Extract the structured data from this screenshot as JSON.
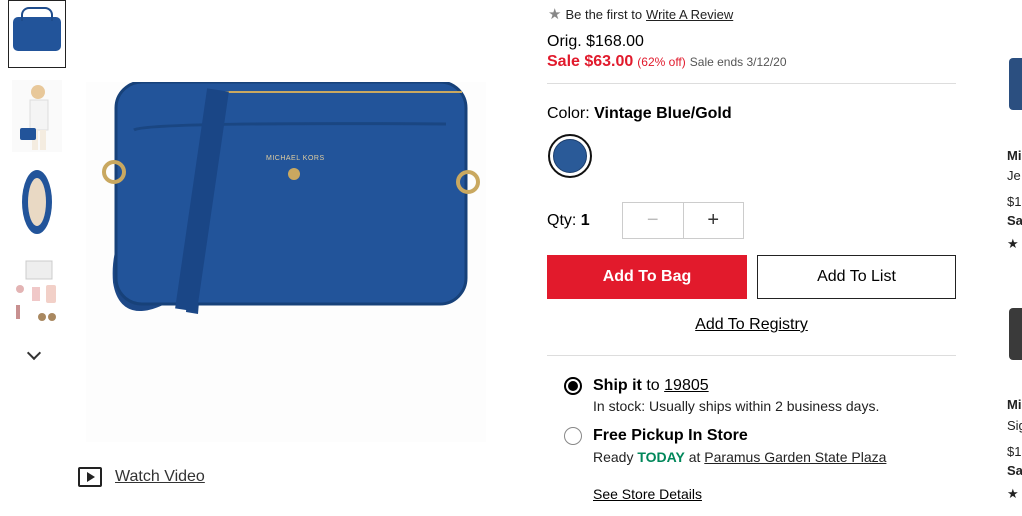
{
  "review": {
    "text": "Be the first to",
    "link": "Write A Review"
  },
  "pricing": {
    "orig": "Orig. $168.00",
    "sale": "Sale $63.00",
    "percent_off": "(62% off)",
    "sale_ends": "Sale ends 3/12/20"
  },
  "color": {
    "label": "Color:",
    "value": "Vintage Blue/Gold",
    "swatch_color": "#2a5a98"
  },
  "quantity": {
    "label": "Qty:",
    "value": "1",
    "minus": "−",
    "plus": "+"
  },
  "buttons": {
    "add_to_bag": "Add To Bag",
    "add_to_list": "Add To List",
    "add_to_registry": "Add To Registry"
  },
  "shipping": {
    "ship_title": "Ship it",
    "ship_to": "to",
    "zip": "19805",
    "ship_stock": "In stock: Usually ships within 2 business days.",
    "pickup_title": "Free Pickup In Store",
    "pickup_ready": "Ready",
    "pickup_today": "TODAY",
    "pickup_at": "at",
    "pickup_store": "Paramus Garden State Plaza",
    "see_store_details": "See Store Details"
  },
  "media": {
    "watch_video": "Watch Video",
    "brand_text": "MICHAEL KORS"
  },
  "recommendations": [
    {
      "name": "Mi",
      "desc": "Je",
      "price": "$1",
      "sale": "Sa",
      "stars": "★"
    },
    {
      "name": "Mi",
      "desc": "Sig",
      "price": "$1",
      "sale": "Sa",
      "stars": "★"
    }
  ],
  "colors": {
    "sale_red": "#e11a2c",
    "bag_button": "#e21a2c",
    "today_green": "#00875a",
    "bag_blue": "#22549a"
  }
}
